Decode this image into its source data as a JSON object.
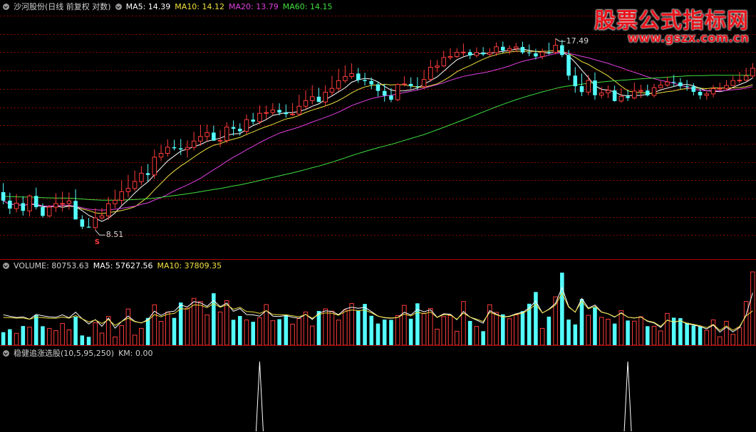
{
  "price_header": {
    "title": "沙河股份(日线 前复权 对数)",
    "ma5": "MA5: 14.39",
    "ma10": "MA10: 14.12",
    "ma20": "MA20: 13.79",
    "ma60": "MA60: 14.15"
  },
  "volume_header": {
    "title": "VOLUME: 80753.63",
    "ma5": "MA5: 57627.56",
    "ma10": "MA10: 37809.35"
  },
  "indicator_header": {
    "title": "稳健追涨选股(10,5,95,250)",
    "km": "KM: 0.00"
  },
  "watermark": {
    "line1": "股票公式指标网",
    "line2": "www.gszx.com.cn"
  },
  "colors": {
    "up": "#ff3c3c",
    "down": "#54ffff",
    "ma5": "#ffffff",
    "ma10": "#f0e040",
    "ma20": "#e040e0",
    "ma60": "#40e040",
    "grid": "#8a0000",
    "divider": "#b00000",
    "text": "#d0d0d0"
  },
  "chart_data": {
    "type": "candlestick",
    "scale": "log",
    "price_range": [
      7.6,
      19.5
    ],
    "annotations": {
      "high": "17.49",
      "low": "8.51",
      "signal_marker": "S"
    },
    "price_series": {
      "open": [
        9.75,
        9.44,
        9.16,
        9.35,
        9.08,
        9.61,
        9.21,
        8.91,
        9.21,
        9.34,
        9.34,
        9.43,
        8.79,
        8.55,
        8.52,
        8.84,
        8.91,
        9.33,
        9.45,
        9.77,
        9.89,
        10.15,
        10.48,
        10.41,
        11.14,
        11.3,
        11.57,
        11.52,
        11.47,
        11.56,
        11.84,
        12.05,
        12.23,
        11.86,
        11.87,
        12.49,
        12.41,
        12.29,
        12.85,
        12.75,
        13.16,
        13.2,
        13.33,
        13.2,
        13.12,
        13.12,
        13.52,
        13.81,
        14.02,
        13.74,
        14.26,
        14.47,
        14.9,
        15.14,
        15.31,
        14.94,
        14.88,
        14.69,
        14.33,
        14.08,
        13.86,
        14.69,
        14.72,
        14.59,
        14.56,
        14.97,
        15.68,
        15.76,
        16.27,
        16.33,
        16.6,
        16.61,
        16.4,
        16.59,
        16.47,
        16.58,
        16.95,
        16.71,
        16.84,
        16.94,
        16.59,
        16.54,
        16.34,
        16.61,
        16.6,
        17.05,
        16.43,
        15.19,
        14.59,
        14.27,
        14.91,
        14.1,
        14.22,
        14.36,
        13.79,
        14.04,
        13.95,
        14.32,
        14.35,
        14.09,
        14.51,
        14.65,
        14.83,
        14.8,
        14.59,
        14.58,
        14.28,
        14.09,
        14.17,
        14.46,
        14.47,
        14.63,
        14.91,
        14.93,
        15.17
      ],
      "high": [
        10.09,
        9.73,
        9.68,
        9.6,
        9.66,
        9.92,
        9.34,
        9.28,
        9.71,
        9.77,
        9.74,
        9.86,
        8.93,
        8.84,
        9.17,
        9.18,
        9.57,
        9.84,
        10.19,
        10.41,
        10.59,
        10.76,
        10.85,
        11.47,
        11.67,
        11.92,
        11.9,
        11.93,
        11.87,
        12.27,
        12.6,
        12.61,
        12.56,
        12.35,
        12.72,
        12.81,
        12.67,
        13.1,
        13.18,
        13.56,
        13.55,
        13.68,
        13.67,
        13.61,
        13.68,
        14.12,
        14.37,
        14.65,
        14.5,
        14.65,
        15.18,
        15.59,
        15.8,
        15.92,
        15.64,
        15.35,
        15.08,
        14.84,
        14.72,
        14.49,
        14.75,
        15.15,
        15.09,
        15.1,
        15.51,
        16.13,
        16.11,
        16.7,
        16.87,
        16.86,
        17.16,
        16.79,
        16.91,
        16.93,
        16.86,
        17.24,
        17.29,
        17.05,
        17.21,
        17.28,
        17.1,
        16.82,
        16.84,
        17.22,
        17.49,
        17.41,
        16.74,
        15.69,
        15.31,
        15.24,
        15.37,
        14.55,
        14.63,
        14.62,
        14.48,
        14.39,
        14.79,
        14.67,
        14.68,
        14.72,
        14.89,
        15.12,
        15.23,
        15.05,
        14.94,
        14.76,
        14.53,
        14.31,
        14.67,
        14.79,
        14.94,
        15.17,
        15.4,
        15.65,
        15.93
      ],
      "low": [
        9.31,
        8.97,
        9.03,
        8.92,
        8.89,
        9.13,
        8.85,
        8.85,
        9.04,
        9.06,
        9.12,
        8.79,
        8.47,
        8.51,
        8.44,
        8.78,
        8.78,
        9.17,
        9.29,
        9.56,
        9.79,
        10.02,
        10.14,
        10.26,
        10.98,
        11.16,
        11.43,
        11.23,
        11.12,
        11.43,
        11.63,
        11.83,
        11.85,
        11.58,
        11.75,
        12.09,
        12.09,
        12.15,
        12.6,
        12.62,
        12.86,
        13.08,
        13.06,
        12.95,
        13.04,
        13.05,
        13.39,
        13.61,
        13.73,
        13.53,
        14.08,
        14.31,
        14.77,
        15.01,
        14.78,
        14.63,
        14.43,
        14.03,
        13.76,
        13.73,
        13.78,
        14.58,
        14.45,
        14.38,
        14.49,
        14.84,
        15.38,
        15.69,
        16.12,
        16.24,
        16.36,
        16.18,
        16.27,
        16.36,
        16.33,
        16.37,
        16.56,
        16.46,
        16.62,
        16.48,
        16.35,
        16.16,
        16.16,
        16.46,
        16.47,
        16.29,
        14.94,
        14.23,
        14.05,
        14.09,
        13.86,
        13.93,
        13.95,
        13.76,
        13.7,
        13.79,
        13.88,
        13.94,
        14.03,
        13.98,
        14.47,
        14.56,
        14.55,
        14.44,
        14.34,
        14.09,
        13.89,
        13.86,
        13.99,
        14.35,
        14.37,
        14.61,
        14.75,
        14.86,
        15.06
      ],
      "close": [
        9.44,
        9.16,
        9.35,
        9.08,
        9.61,
        9.21,
        8.91,
        9.21,
        9.34,
        9.34,
        9.43,
        8.79,
        8.55,
        8.52,
        8.84,
        8.91,
        9.33,
        9.45,
        9.77,
        9.89,
        10.15,
        10.48,
        10.41,
        11.14,
        11.3,
        11.57,
        11.52,
        11.47,
        11.56,
        11.84,
        12.05,
        12.23,
        11.86,
        11.87,
        12.49,
        12.41,
        12.29,
        12.85,
        12.75,
        13.16,
        13.2,
        13.33,
        13.2,
        13.12,
        13.12,
        13.52,
        13.81,
        14.02,
        13.74,
        14.26,
        14.47,
        14.9,
        15.14,
        15.31,
        14.94,
        14.88,
        14.69,
        14.33,
        14.08,
        13.86,
        14.69,
        14.72,
        14.59,
        14.56,
        14.97,
        15.68,
        15.76,
        16.27,
        16.33,
        16.6,
        16.61,
        16.4,
        16.59,
        16.47,
        16.58,
        16.95,
        16.71,
        16.84,
        16.94,
        16.59,
        16.54,
        16.34,
        16.61,
        16.6,
        17.05,
        16.43,
        15.19,
        14.59,
        14.27,
        14.91,
        14.1,
        14.22,
        14.36,
        13.79,
        14.04,
        13.95,
        14.32,
        14.35,
        14.09,
        14.51,
        14.65,
        14.83,
        14.8,
        14.59,
        14.58,
        14.28,
        14.09,
        14.17,
        14.46,
        14.47,
        14.63,
        14.91,
        14.93,
        15.17,
        15.62
      ]
    },
    "volume": [
      14280,
      17560,
      13120,
      21080,
      19830,
      33070,
      20860,
      18480,
      16000,
      23980,
      16850,
      31330,
      10700,
      9180,
      24800,
      13300,
      31620,
      9040,
      21500,
      39830,
      11100,
      18530,
      30010,
      44460,
      26240,
      36340,
      30030,
      46950,
      40690,
      51550,
      48010,
      33380,
      57200,
      36590,
      49070,
      27950,
      32140,
      27780,
      25760,
      30260,
      44760,
      27000,
      28610,
      32700,
      23230,
      29310,
      36620,
      21090,
      37670,
      39950,
      37410,
      27660,
      38800,
      45840,
      38000,
      45430,
      32340,
      23820,
      28180,
      27860,
      32490,
      43860,
      29140,
      46090,
      35120,
      40420,
      17700,
      31430,
      32550,
      15330,
      48040,
      26710,
      20680,
      15400,
      44560,
      36180,
      33920,
      29100,
      33340,
      37460,
      45660,
      58540,
      18500,
      31440,
      53220,
      79910,
      28230,
      22840,
      50790,
      32950,
      41660,
      30630,
      28670,
      23780,
      38130,
      27170,
      26480,
      31330,
      20880,
      20870,
      15740,
      35010,
      30320,
      29740,
      24620,
      21670,
      20270,
      16370,
      27830,
      9240,
      26340,
      11970,
      19270,
      48150,
      80753
    ],
    "volume_ma5": [
      33500,
      31800,
      30500,
      31200,
      28600,
      33900,
      32300,
      31100,
      30700,
      33400,
      30300,
      36300,
      29200,
      23300,
      28200,
      20800,
      29800,
      18700,
      26100,
      32100,
      26300,
      24500,
      28200,
      37500,
      32700,
      36600,
      37400,
      44300,
      42100,
      48000,
      46600,
      42700,
      49200,
      42400,
      46400,
      37300,
      40300,
      33700,
      33400,
      32000,
      38100,
      32000,
      31500,
      32700,
      30800,
      29600,
      34000,
      28400,
      35100,
      37800,
      37200,
      33600,
      39800,
      41900,
      40500,
      41700,
      37000,
      32000,
      30200,
      29700,
      30400,
      36300,
      33300,
      39400,
      36800,
      39000,
      30700,
      34600,
      34100,
      28000,
      37200,
      30900,
      27600,
      24200,
      38100,
      34100,
      31100,
      31900,
      34600,
      36200,
      40900,
      48600,
      35400,
      39700,
      46000,
      63600,
      42600,
      36300,
      51400,
      40900,
      44200,
      36600,
      34600,
      30900,
      35700,
      30800,
      29900,
      31100,
      26300,
      24500,
      19500,
      27700,
      25300,
      26800,
      23600,
      22300,
      20500,
      17900,
      22100,
      14400,
      19800,
      14700,
      19400,
      33600,
      57628
    ],
    "volume_ma10": [
      30600,
      30300,
      29800,
      30000,
      28500,
      31000,
      30300,
      29700,
      29600,
      31000,
      29700,
      32600,
      29100,
      25600,
      27700,
      23800,
      28200,
      21800,
      26100,
      29800,
      25900,
      24700,
      27100,
      33700,
      31200,
      34200,
      34900,
      40300,
      39700,
      44400,
      44000,
      41400,
      45900,
      41800,
      44600,
      39600,
      41700,
      37000,
      36700,
      35000,
      38000,
      33900,
      33500,
      33500,
      32400,
      31300,
      33800,
      29600,
      33900,
      35500,
      35200,
      33000,
      37100,
      38800,
      38000,
      38700,
      35700,
      31900,
      30500,
      30000,
      30500,
      34300,
      32200,
      36400,
      34600,
      36500,
      30500,
      33700,
      33200,
      28600,
      35300,
      30900,
      28600,
      26000,
      36200,
      33500,
      31000,
      31500,
      33800,
      35300,
      39200,
      45000,
      35600,
      39200,
      44300,
      57500,
      41900,
      36600,
      48400,
      40100,
      42800,
      36300,
      34600,
      31300,
      35100,
      30800,
      30100,
      30900,
      26800,
      25100,
      20800,
      27400,
      25600,
      26800,
      24200,
      23000,
      21400,
      19300,
      22900,
      16200,
      21200,
      16500,
      20600,
      32400,
      37809
    ],
    "indicator_km": {
      "baseline": 0,
      "spikes_at_index": [
        39,
        95
      ],
      "last_value": 0.0
    }
  }
}
